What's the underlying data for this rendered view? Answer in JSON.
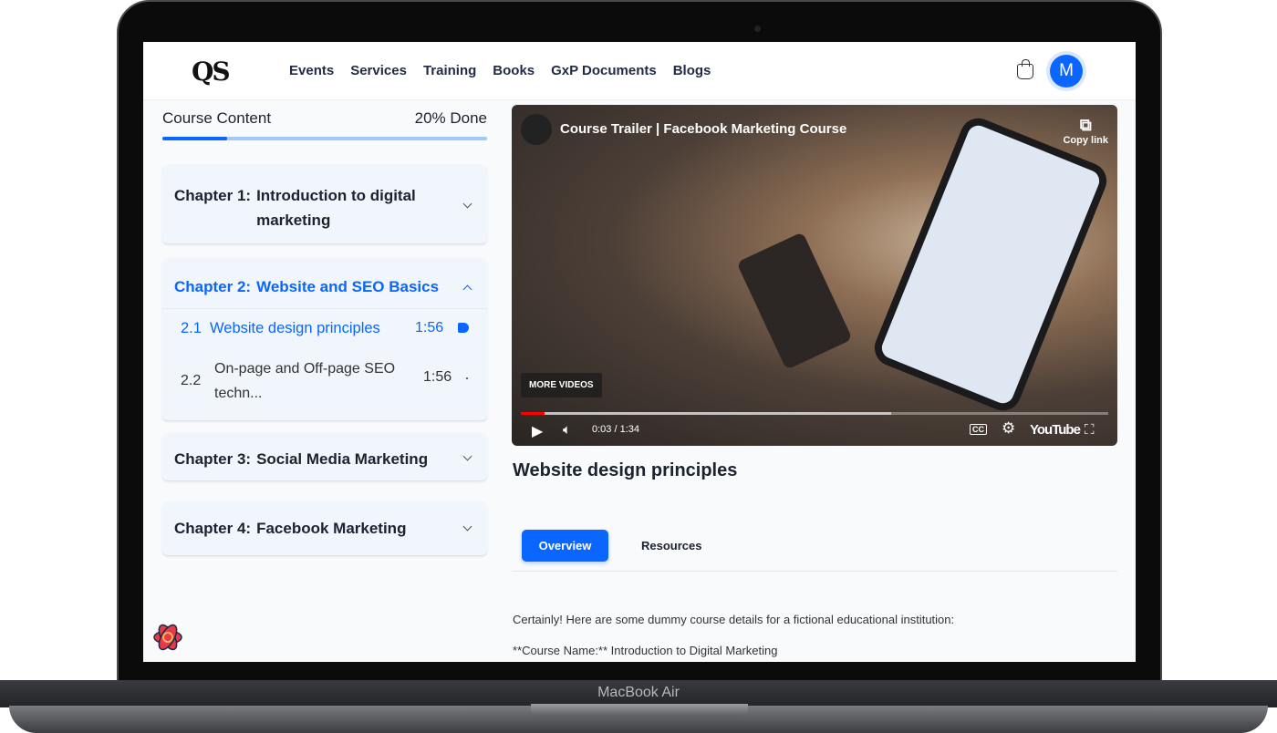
{
  "nav": {
    "logo": "QS",
    "links": [
      "Events",
      "Services",
      "Training",
      "Books",
      "GxP Documents",
      "Blogs"
    ],
    "avatar_initial": "M"
  },
  "sidebar": {
    "title": "Course Content",
    "progress_label": "20% Done",
    "progress": 0.2,
    "chapters": [
      {
        "num": "Chapter 1:",
        "title": "Introduction to digital marketing",
        "expanded": false
      },
      {
        "num": "Chapter 2:",
        "title": "Website and SEO Basics",
        "expanded": true,
        "lessons": [
          {
            "num": "2.1",
            "title": "Website design principles",
            "duration": "1:56",
            "active": true
          },
          {
            "num": "2.2",
            "title": "On-page and Off-page SEO techn...",
            "duration": "1:56",
            "active": false
          }
        ]
      },
      {
        "num": "Chapter 3:",
        "title": "Social Media Marketing",
        "expanded": false
      },
      {
        "num": "Chapter 4:",
        "title": "Facebook Marketing",
        "expanded": false
      }
    ]
  },
  "video": {
    "title": "Course Trailer | Facebook Marketing Course",
    "copy_link": "Copy link",
    "more_videos": "MORE VIDEOS",
    "time": "0:03 / 1:34",
    "played": 0.04,
    "youtube": "YouTube",
    "cc": "CC"
  },
  "main": {
    "lesson_title": "Website design principles",
    "tabs": [
      "Overview",
      "Resources"
    ],
    "paragraphs": [
      "Certainly! Here are some dummy course details for a fictional educational institution:",
      "**Course Name:** Introduction to Digital Marketing"
    ]
  },
  "device": {
    "label": "MacBook Air"
  },
  "colors": {
    "accent": "#0a66ff",
    "progress_track": "#a5c8fb"
  }
}
